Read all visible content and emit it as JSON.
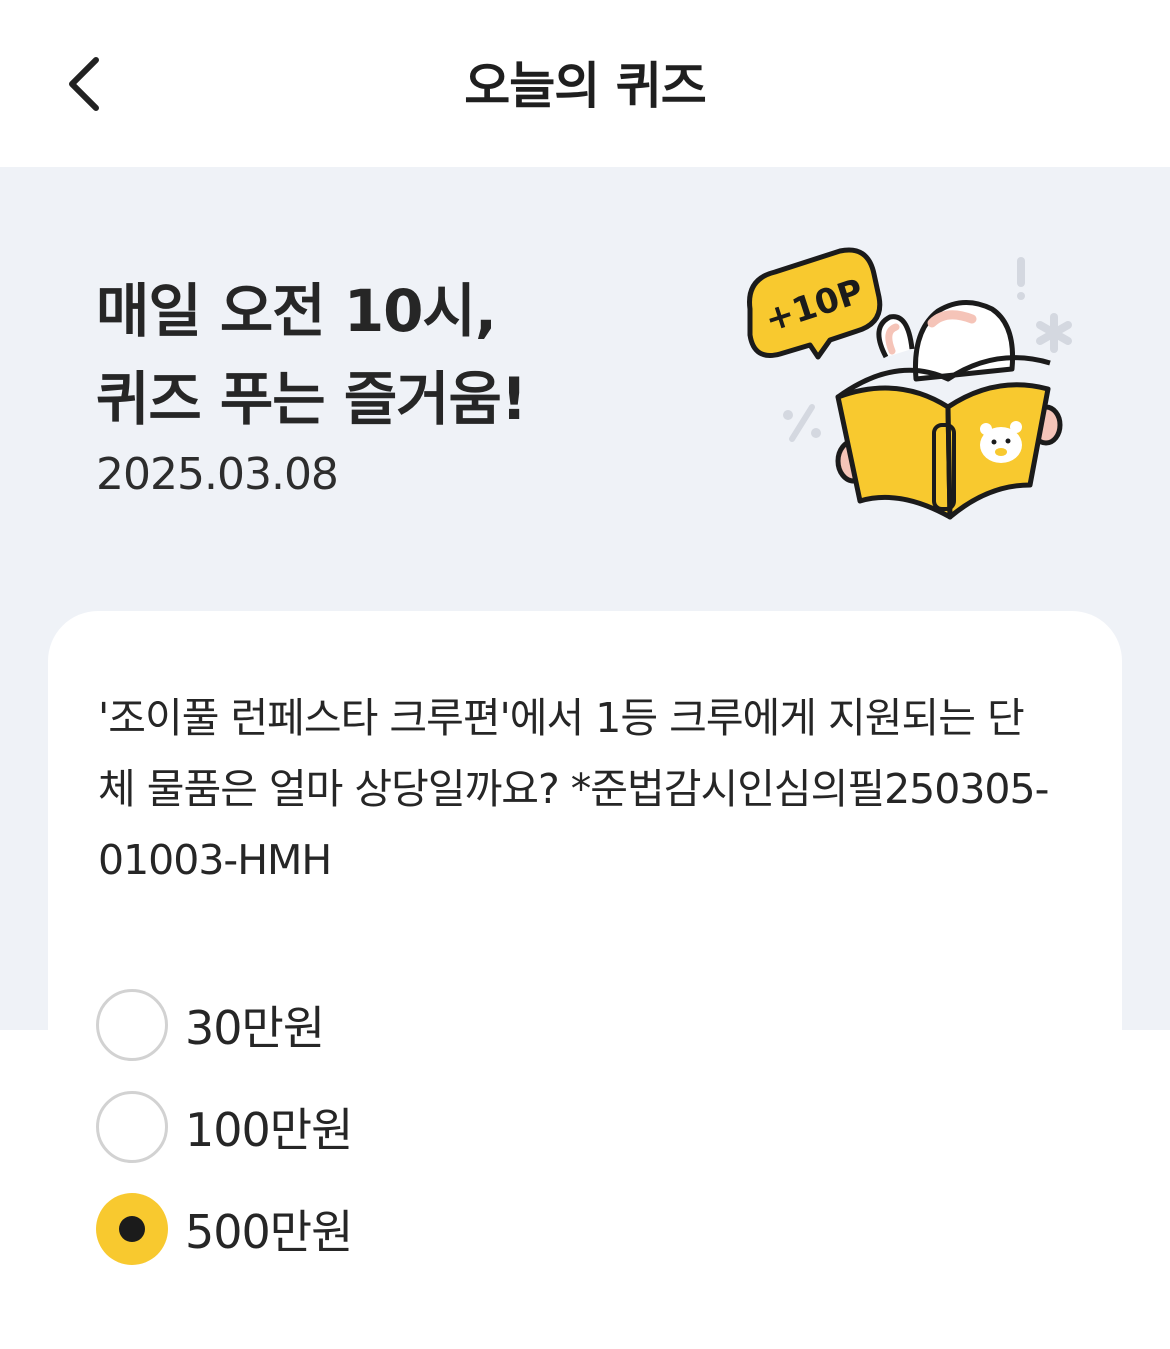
{
  "header": {
    "title": "오늘의 퀴즈"
  },
  "hero": {
    "title_line1": "매일 오전 10시,",
    "title_line2": "퀴즈 푸는 즐거움!",
    "date": "2025.03.08",
    "badge": "+10P"
  },
  "quiz": {
    "question": "'조이풀 런페스타 크루편'에서 1등 크루에게 지원되는 단체 물품은 얼마 상당일까요? *준법감시인심의필250305-01003-HMH",
    "options": [
      {
        "label": "30만원",
        "selected": false
      },
      {
        "label": "100만원",
        "selected": false
      },
      {
        "label": "500만원",
        "selected": true
      }
    ]
  },
  "colors": {
    "accent": "#f8c92f",
    "hero_bg": "#eff2f7",
    "text": "#262626"
  }
}
